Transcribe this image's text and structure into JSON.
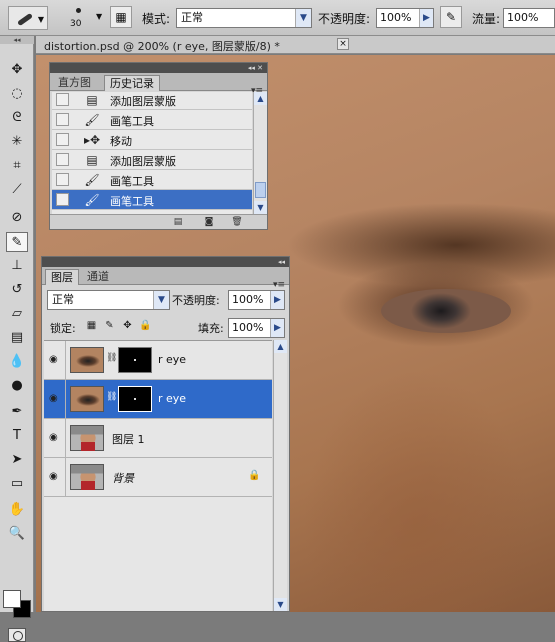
{
  "options_bar": {
    "brush_size": "30",
    "mode_label": "模式:",
    "mode_value": "正常",
    "opacity_label": "不透明度:",
    "opacity_value": "100%",
    "flow_label": "流量:",
    "flow_value": "100%"
  },
  "document": {
    "tab_title": "distortion.psd @ 200% (r eye, 图层蒙版/8) *",
    "close_glyph": "×"
  },
  "history_panel": {
    "tabs": [
      "直方图",
      "历史记录"
    ],
    "active_tab": "历史记录",
    "items": [
      {
        "icon": "document-icon",
        "label": "添加图层蒙版"
      },
      {
        "icon": "brush-icon",
        "label": "画笔工具"
      },
      {
        "icon": "move-icon",
        "label": "移动"
      },
      {
        "icon": "document-icon",
        "label": "添加图层蒙版"
      },
      {
        "icon": "brush-icon",
        "label": "画笔工具"
      },
      {
        "icon": "brush-icon",
        "label": "画笔工具",
        "selected": true
      }
    ]
  },
  "layers_panel": {
    "tabs": [
      "图层",
      "通道"
    ],
    "active_tab": "图层",
    "blend_mode": "正常",
    "opacity_label": "不透明度:",
    "opacity_value": "100%",
    "lock_label": "锁定:",
    "fill_label": "填充:",
    "fill_value": "100%",
    "layers": [
      {
        "name": "r eye",
        "has_mask": true,
        "selected": false
      },
      {
        "name": "r eye",
        "has_mask": true,
        "selected": true
      },
      {
        "name": "图层 1",
        "has_mask": false,
        "selected": false
      },
      {
        "name": "背景",
        "has_mask": false,
        "locked": true,
        "selected": false
      }
    ]
  },
  "colors": {
    "selection": "#2f6ac9",
    "foreground": "#ffffff",
    "background": "#000000"
  }
}
